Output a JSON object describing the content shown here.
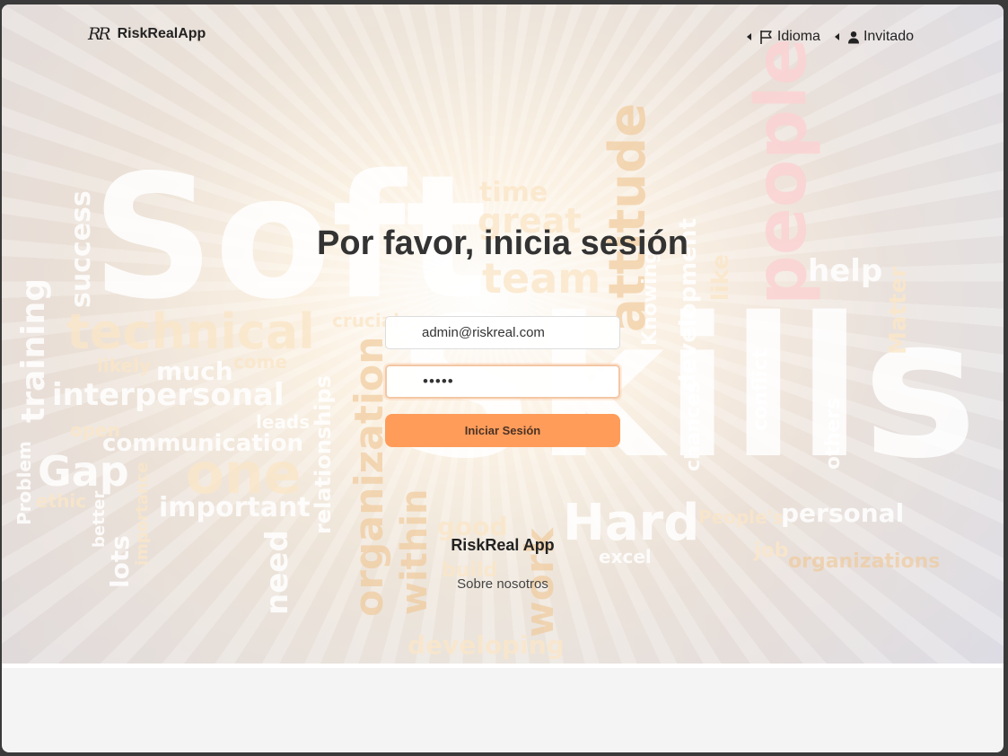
{
  "nav": {
    "brand_logo": "RR",
    "brand_name": "RiskRealApp",
    "language_label": "Idioma",
    "user_label": "Invitado"
  },
  "login": {
    "title": "Por favor, inicia sesión",
    "email_value": "admin@riskreal.com",
    "password_value": "•••••",
    "submit_label": "Iniciar Sesión"
  },
  "footer": {
    "app_name": "RiskReal App",
    "about_label": "Sobre nosotros"
  },
  "background_words": [
    "Soft",
    "Skills",
    "people",
    "technical",
    "interpersonal",
    "communication",
    "Gap",
    "one",
    "important",
    "Hard",
    "personal",
    "organization",
    "training",
    "team",
    "great",
    "time",
    "attitude",
    "help",
    "success",
    "developing",
    "organizations",
    "excel",
    "good",
    "work",
    "within",
    "need",
    "lots",
    "development",
    "like",
    "Knowing",
    "Matter",
    "much",
    "leads",
    "ethic",
    "open",
    "build",
    "job",
    "People's",
    "others",
    "conflict",
    "chances",
    "crucial",
    "likely",
    "come",
    "Problem",
    "better",
    "importance",
    "relationships"
  ],
  "colors": {
    "accent_button": "#ff9c5a",
    "title_text": "#333333"
  }
}
